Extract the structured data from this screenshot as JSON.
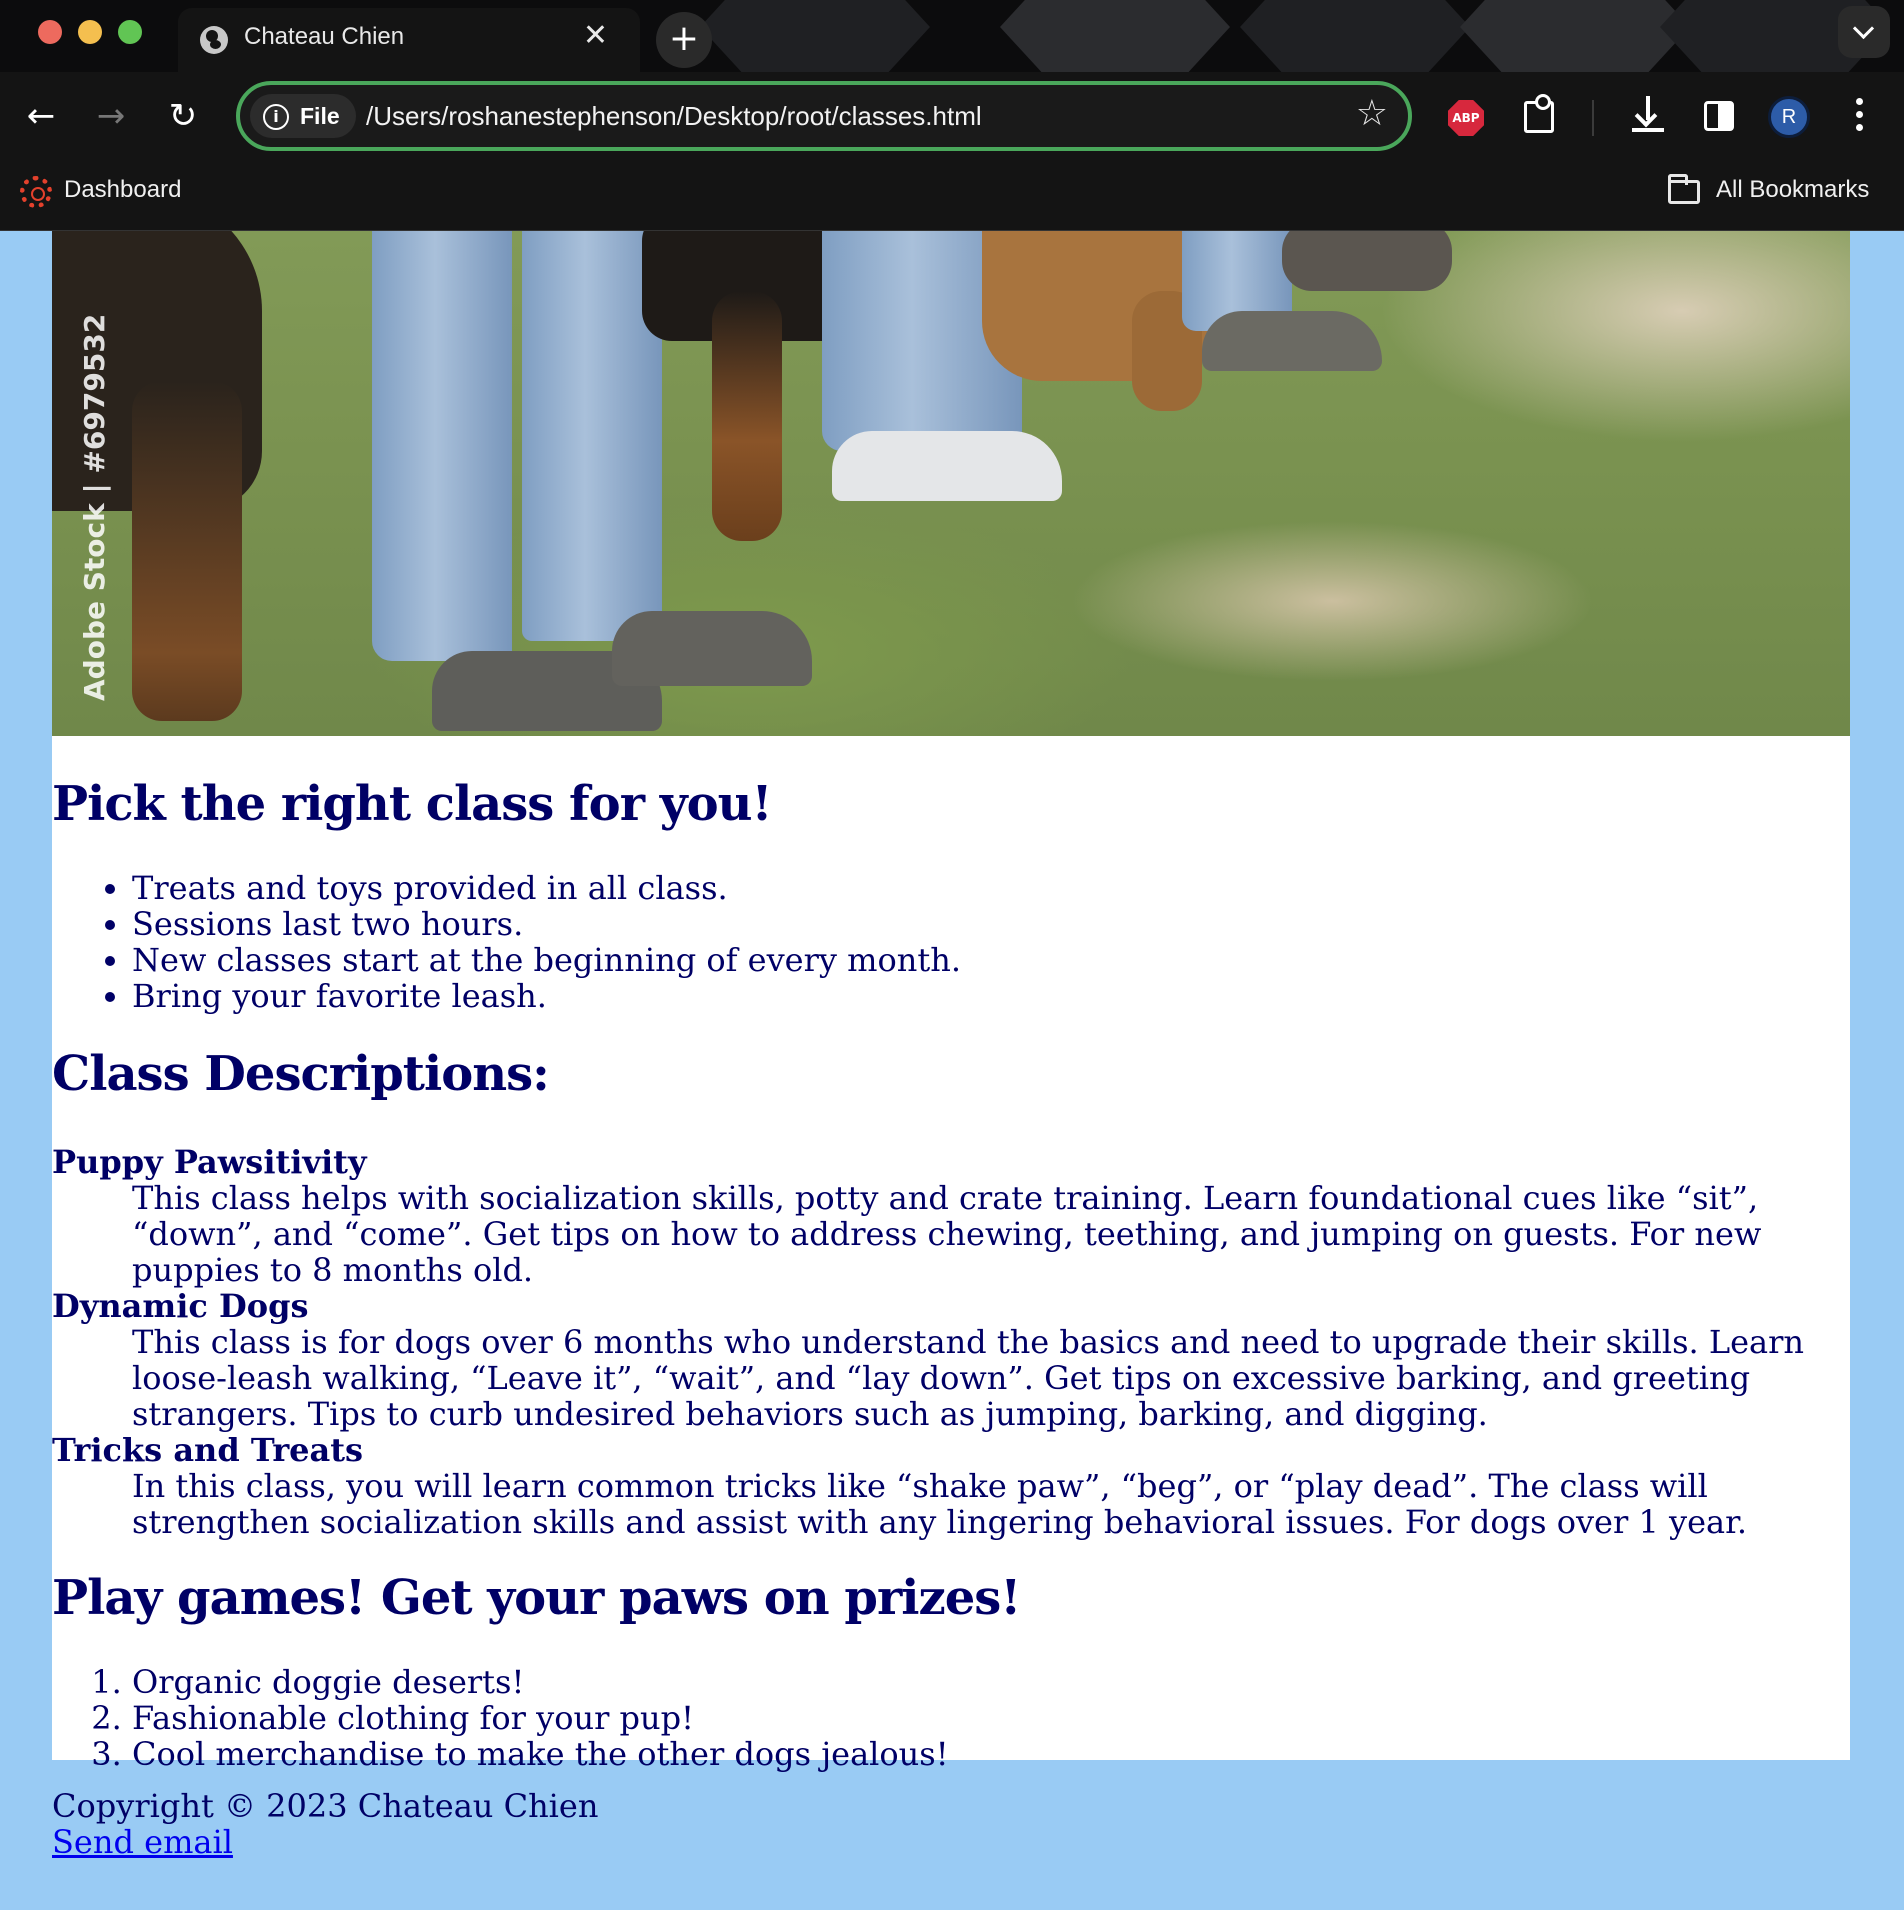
{
  "browser": {
    "tab_title": "Chateau Chien",
    "tab_close": "✕",
    "new_tab": "+",
    "back": "←",
    "forward": "→",
    "reload": "↻",
    "file_chip": "File",
    "url": "/Users/roshanestephenson/Desktop/root/classes.html",
    "star": "☆",
    "adblock_label": "ABP",
    "profile_initial": "R",
    "bookmarks": {
      "dashboard": "Dashboard",
      "all": "All Bookmarks"
    },
    "traffic_lights": [
      "#ed6a5e",
      "#f4bf4f",
      "#61c554"
    ]
  },
  "page": {
    "hero_watermark": "Adobe Stock | #6979532",
    "heading_classes": "Pick the right class for you!",
    "features": [
      "Treats and toys provided in all class.",
      "Sessions last two hours.",
      "New classes start at the beginning of every month.",
      "Bring your favorite leash."
    ],
    "heading_descriptions": "Class Descriptions:",
    "classes": [
      {
        "name": "Puppy Pawsitivity",
        "description": "This class helps with socialization skills, potty and crate training. Learn foundational cues like “sit”, “down”, and “come”. Get tips on how to address chewing, teething, and jumping on guests. For new puppies to 8 months old."
      },
      {
        "name": "Dynamic Dogs",
        "description": "This class is for dogs over 6 months who understand the basics and need to upgrade their skills. Learn loose-leash walking, “Leave it”, “wait”, and “lay down”. Get tips on excessive barking, and greeting strangers. Tips to curb undesired behaviors such as jumping, barking, and digging."
      },
      {
        "name": "Tricks and Treats",
        "description": "In this class, you will learn common tricks like “shake paw”, “beg”, or “play dead”. The class will strengthen socialization skills and assist with any lingering behavioral issues. For dogs over 1 year."
      }
    ],
    "heading_prizes": "Play games! Get your paws on prizes!",
    "prizes": [
      "Organic doggie deserts!",
      "Fashionable clothing for your pup!",
      "Cool merchandise to make the other dogs jealous!"
    ]
  },
  "footer": {
    "copyright": "Copyright © 2023 Chateau Chien",
    "email_link": "Send email"
  },
  "colors": {
    "page_background": "#99cbf4",
    "content_background": "#ffffff",
    "text": "#000066",
    "link": "#0000ee",
    "omnibox_border": "#4aa75b"
  }
}
